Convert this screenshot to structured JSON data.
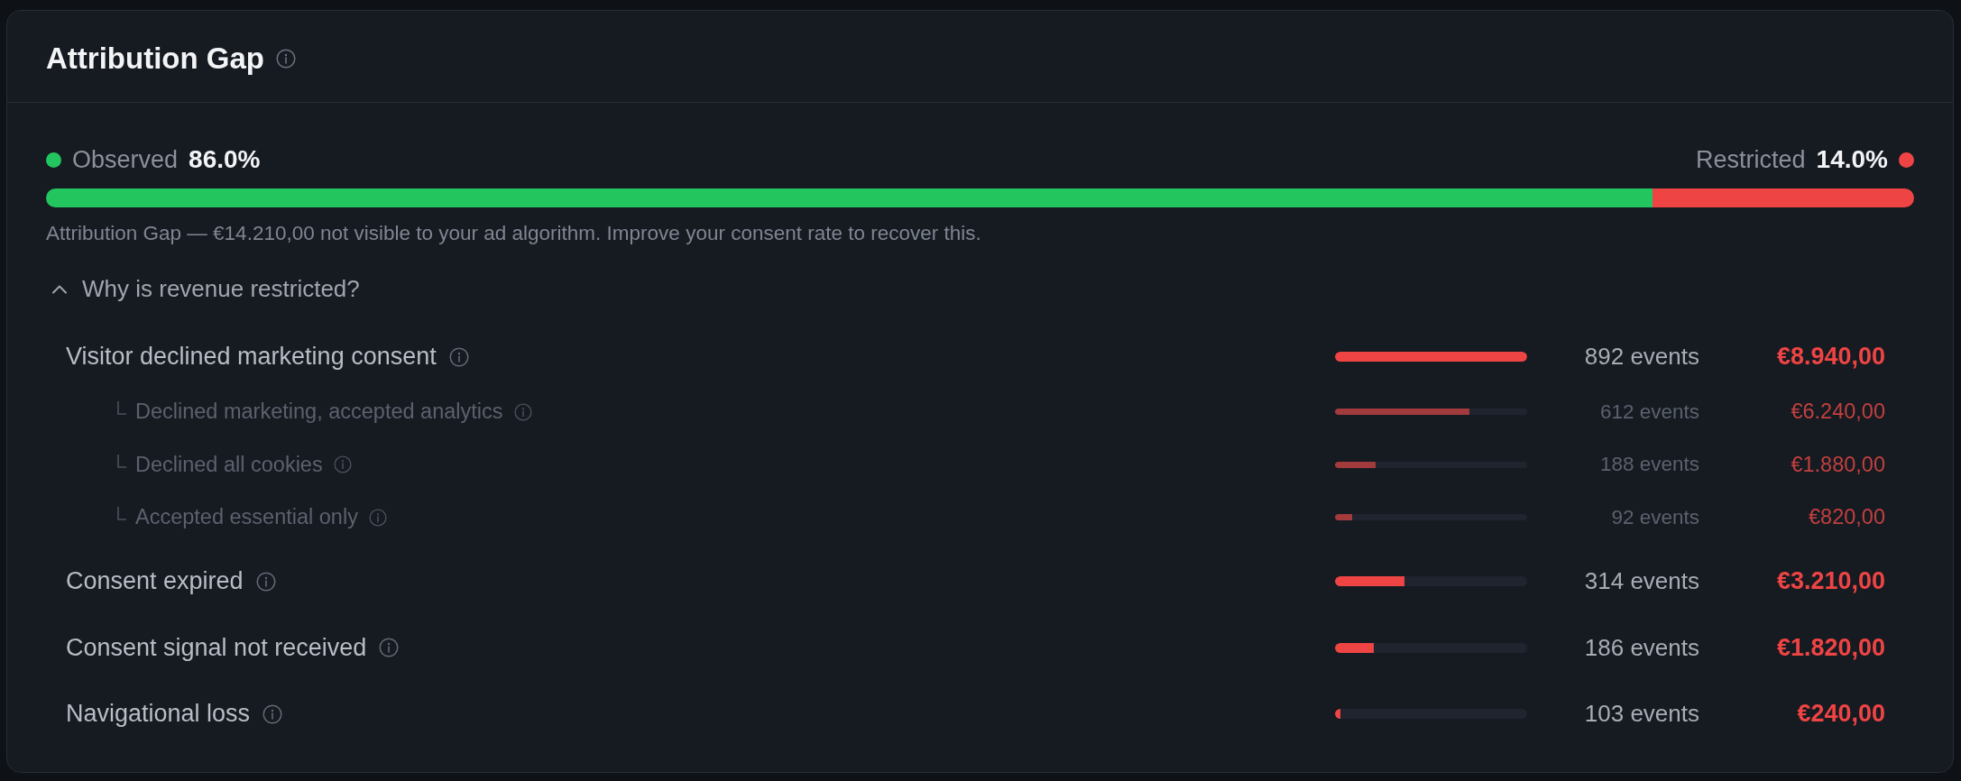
{
  "card": {
    "title": "Attribution Gap"
  },
  "split": {
    "segments": [
      {
        "label": "Observed",
        "value": "86.0%",
        "color": "#22c55e",
        "level": 0.86
      },
      {
        "label": "Restricted",
        "value": "14.0%",
        "color": "#ef4444",
        "level": 0.14
      }
    ],
    "note": "Attribution Gap — €14.210,00 not visible to your ad algorithm. Improve your consent rate to recover this."
  },
  "breakdown": {
    "toggle": "Why is revenue restricted?",
    "expanded": true,
    "rows": [
      {
        "label": "Visitor declined marketing consent",
        "events": "892 events",
        "amount": "€8.940,00",
        "level": 1,
        "children": [
          {
            "label": "Declined marketing, accepted analytics",
            "events": "612 events",
            "amount": "€6.240,00",
            "level": 0.7
          },
          {
            "label": "Declined all cookies",
            "events": "188 events",
            "amount": "€1.880,00",
            "level": 0.21
          },
          {
            "label": "Accepted essential only",
            "events": "92 events",
            "amount": "€820,00",
            "level": 0.09
          }
        ]
      },
      {
        "label": "Consent expired",
        "events": "314 events",
        "amount": "€3.210,00",
        "level": 0.36
      },
      {
        "label": "Consent signal not received",
        "events": "186 events",
        "amount": "€1.820,00",
        "level": 0.2
      },
      {
        "label": "Navigational loss",
        "events": "103 events",
        "amount": "€240,00",
        "level": 0.03
      }
    ]
  }
}
